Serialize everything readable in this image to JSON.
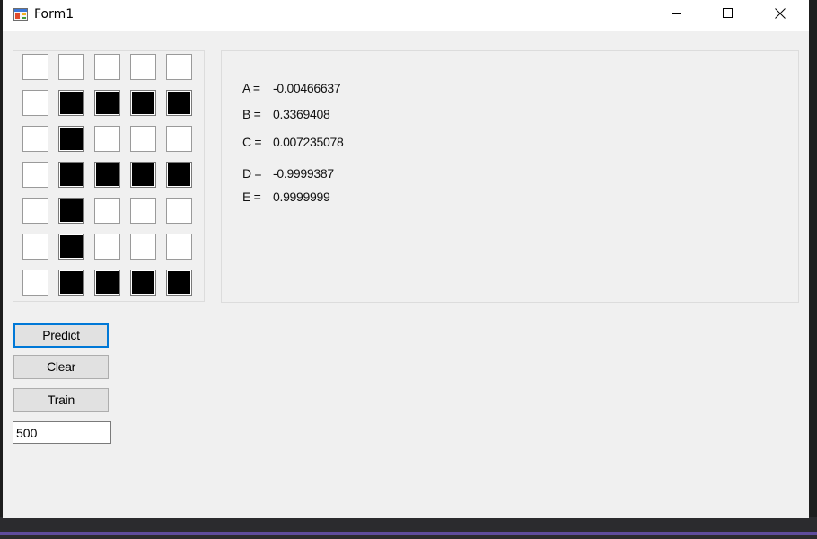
{
  "window": {
    "title": "Form1"
  },
  "grid": {
    "rows": 7,
    "cols": 5,
    "cells": [
      [
        0,
        0,
        0,
        0,
        0
      ],
      [
        0,
        1,
        1,
        1,
        1
      ],
      [
        0,
        1,
        0,
        0,
        0
      ],
      [
        0,
        1,
        1,
        1,
        1
      ],
      [
        0,
        1,
        0,
        0,
        0
      ],
      [
        0,
        1,
        0,
        0,
        0
      ],
      [
        0,
        1,
        1,
        1,
        1
      ]
    ]
  },
  "outputs": [
    {
      "label": "A =",
      "value": "-0.00466637"
    },
    {
      "label": "B =",
      "value": "0.3369408"
    },
    {
      "label": "C =",
      "value": "0.007235078"
    },
    {
      "label": "D =",
      "value": "-0.9999387"
    },
    {
      "label": "E =",
      "value": "0.9999999"
    }
  ],
  "buttons": {
    "predict": "Predict",
    "clear": "Clear",
    "train": "Train"
  },
  "iterations": {
    "value": "500"
  },
  "icons": {
    "app": "form-app-icon",
    "minimize": "minimize-icon",
    "maximize": "maximize-icon",
    "close": "close-icon"
  }
}
